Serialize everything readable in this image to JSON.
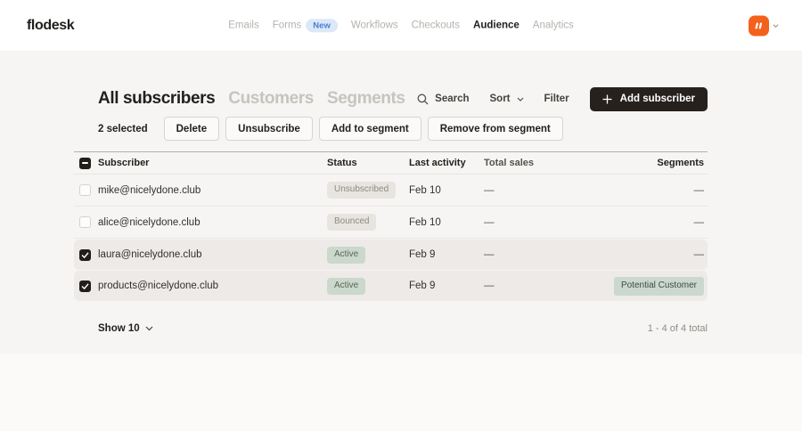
{
  "header": {
    "logo": "flodesk",
    "nav": [
      {
        "label": "Emails",
        "active": false
      },
      {
        "label": "Forms",
        "active": false,
        "badge": "New"
      },
      {
        "label": "Workflows",
        "active": false
      },
      {
        "label": "Checkouts",
        "active": false
      },
      {
        "label": "Audience",
        "active": true
      },
      {
        "label": "Analytics",
        "active": false
      }
    ]
  },
  "toolbar": {
    "tabs": [
      {
        "label": "All subscribers",
        "active": true
      },
      {
        "label": "Customers",
        "active": false
      },
      {
        "label": "Segments",
        "active": false
      }
    ],
    "search_label": "Search",
    "sort_label": "Sort",
    "filter_label": "Filter",
    "add_subscriber_label": "Add subscriber"
  },
  "actions": {
    "selected_text": "2 selected",
    "buttons": [
      "Delete",
      "Unsubscribe",
      "Add to segment",
      "Remove from segment"
    ]
  },
  "table": {
    "columns": [
      "Subscriber",
      "Status",
      "Last activity",
      "Total sales",
      "Segments"
    ],
    "rows": [
      {
        "email": "mike@nicelydone.club",
        "status": "Unsubscribed",
        "status_type": "gray",
        "last_activity": "Feb 10",
        "total_sales": "—",
        "segments": "—",
        "checked": false
      },
      {
        "email": "alice@nicelydone.club",
        "status": "Bounced",
        "status_type": "gray",
        "last_activity": "Feb 10",
        "total_sales": "—",
        "segments": "—",
        "checked": false
      },
      {
        "email": "laura@nicelydone.club",
        "status": "Active",
        "status_type": "green",
        "last_activity": "Feb 9",
        "total_sales": "—",
        "segments": "—",
        "checked": true
      },
      {
        "email": "products@nicelydone.club",
        "status": "Active",
        "status_type": "green",
        "last_activity": "Feb 9",
        "total_sales": "—",
        "segments_badge": "Potential Customer",
        "checked": true
      }
    ]
  },
  "footer": {
    "show_label": "Show 10",
    "range_text": "1 - 4 of 4 total"
  },
  "colors": {
    "brand_orange": "#f4611a",
    "dark_button": "#26211d",
    "panel_bg": "#f6f5f3",
    "selected_row_bg": "#edeae7",
    "badge_gray_bg": "#e8e5e1",
    "badge_green_bg": "#cbd8cc",
    "segment_badge_bg": "#cbd8cf",
    "new_badge_bg": "#dce8f8",
    "new_badge_text": "#4a7ed2"
  }
}
